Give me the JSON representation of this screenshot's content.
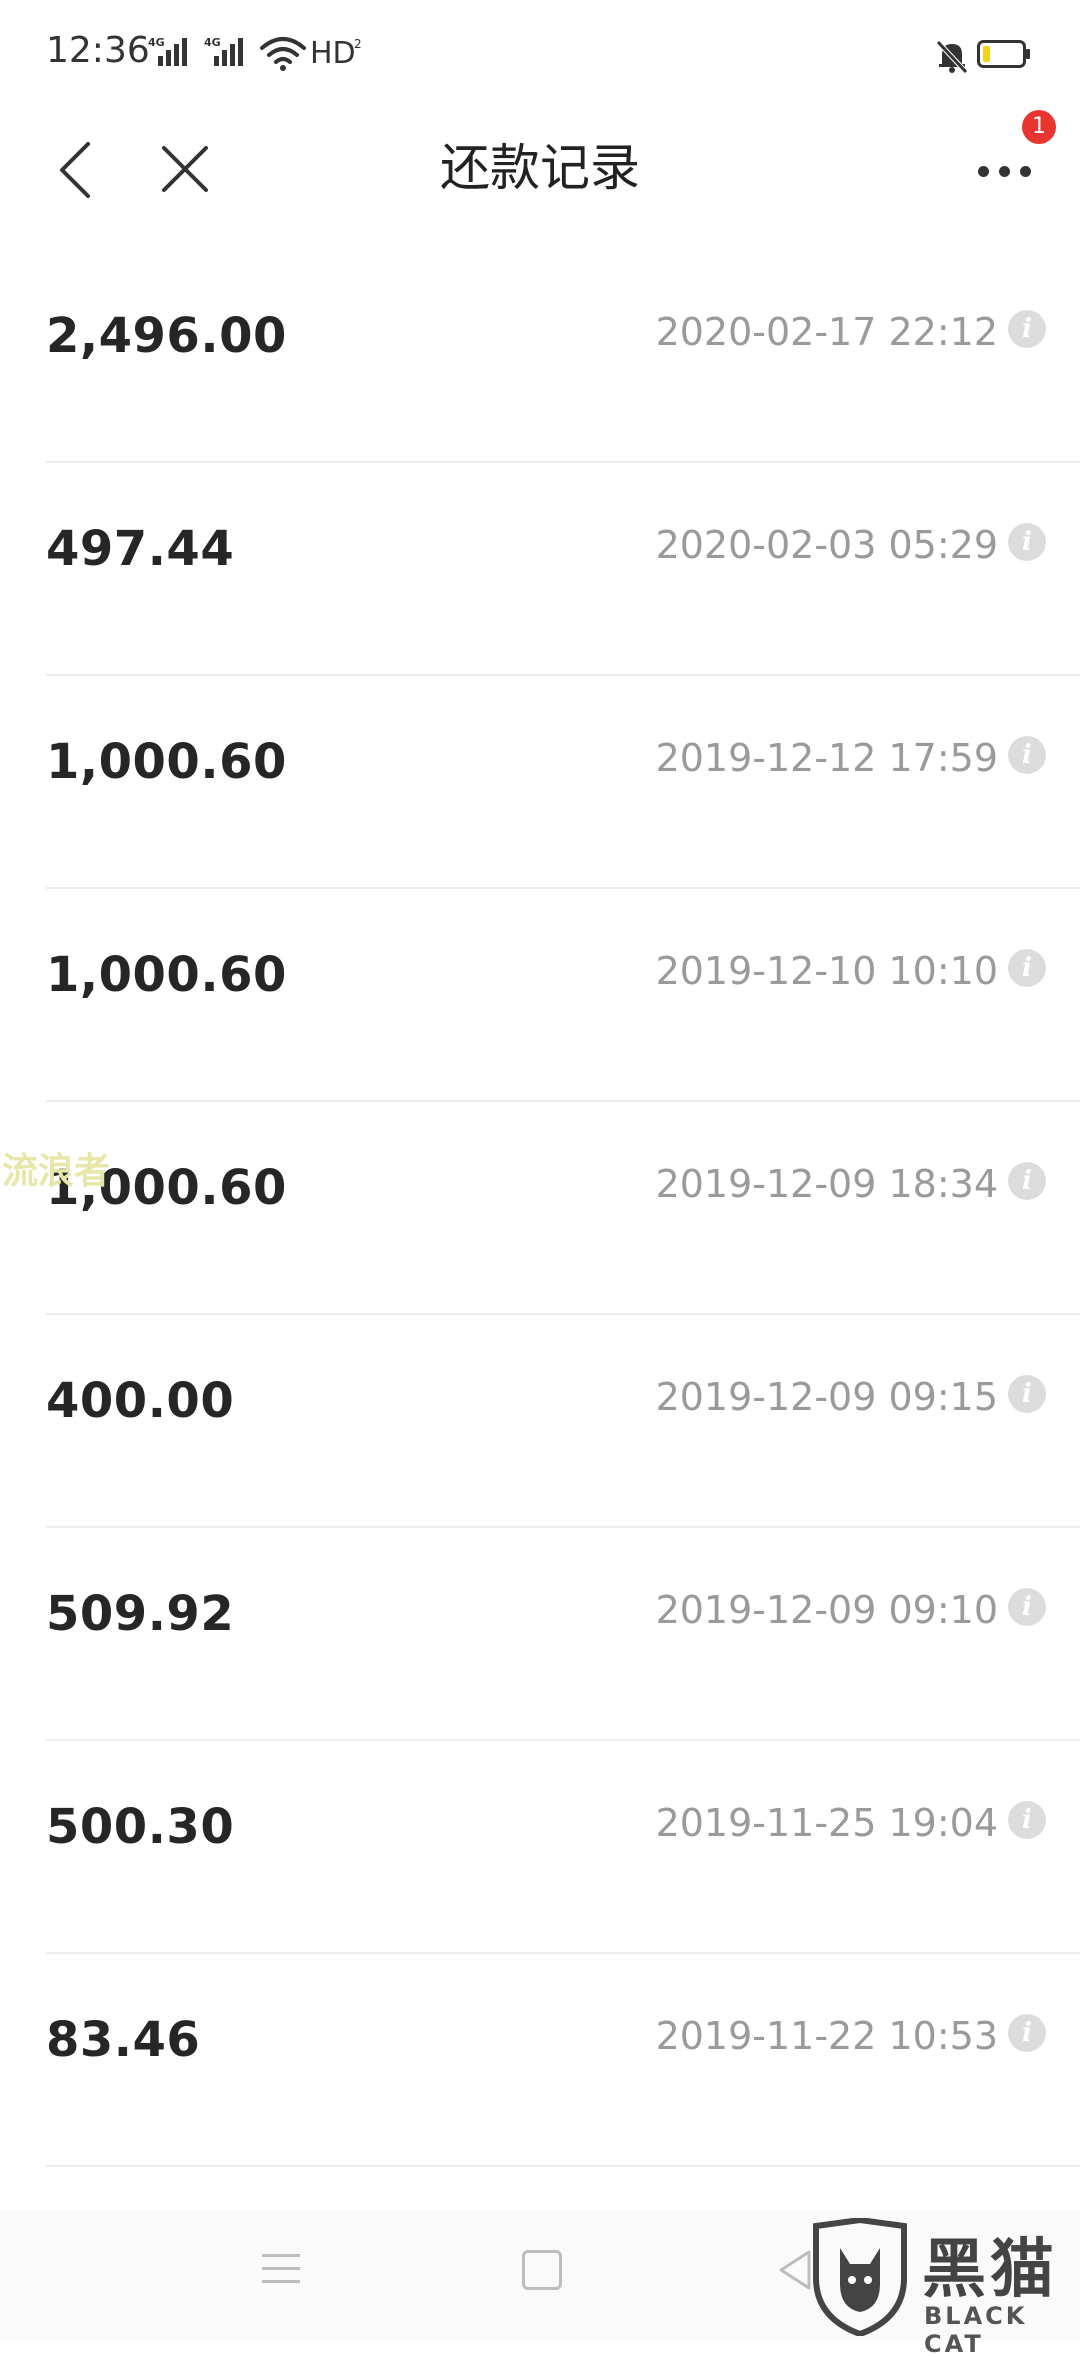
{
  "status_bar": {
    "time": "12:36",
    "network_1": "4G",
    "network_2": "4G",
    "hd_label": "HD",
    "hd_sub": "2",
    "icons": [
      "signal-icon",
      "signal-icon",
      "wifi-icon",
      "bell-muted-icon",
      "battery-icon"
    ]
  },
  "header": {
    "title": "还款记录",
    "notification_count": "1",
    "icons": [
      "back-icon",
      "close-icon",
      "more-icon"
    ]
  },
  "records": [
    {
      "amount": "2,496.00",
      "time": "2020-02-17 22:12"
    },
    {
      "amount": "497.44",
      "time": "2020-02-03 05:29"
    },
    {
      "amount": "1,000.60",
      "time": "2019-12-12 17:59"
    },
    {
      "amount": "1,000.60",
      "time": "2019-12-10 10:10"
    },
    {
      "amount": "1,000.60",
      "time": "2019-12-09 18:34"
    },
    {
      "amount": "400.00",
      "time": "2019-12-09 09:15"
    },
    {
      "amount": "509.92",
      "time": "2019-12-09 09:10"
    },
    {
      "amount": "500.30",
      "time": "2019-11-25 19:04"
    },
    {
      "amount": "83.46",
      "time": "2019-11-22 10:53"
    }
  ],
  "info_icon_glyph": "i",
  "watermark": {
    "text": "流浪者",
    "logo_cn": "黑猫",
    "logo_en": "BLACK CAT"
  },
  "colors": {
    "badge": "#e8352f",
    "amount": "#262626",
    "time": "#9a9a9a",
    "divider": "#ececec"
  }
}
